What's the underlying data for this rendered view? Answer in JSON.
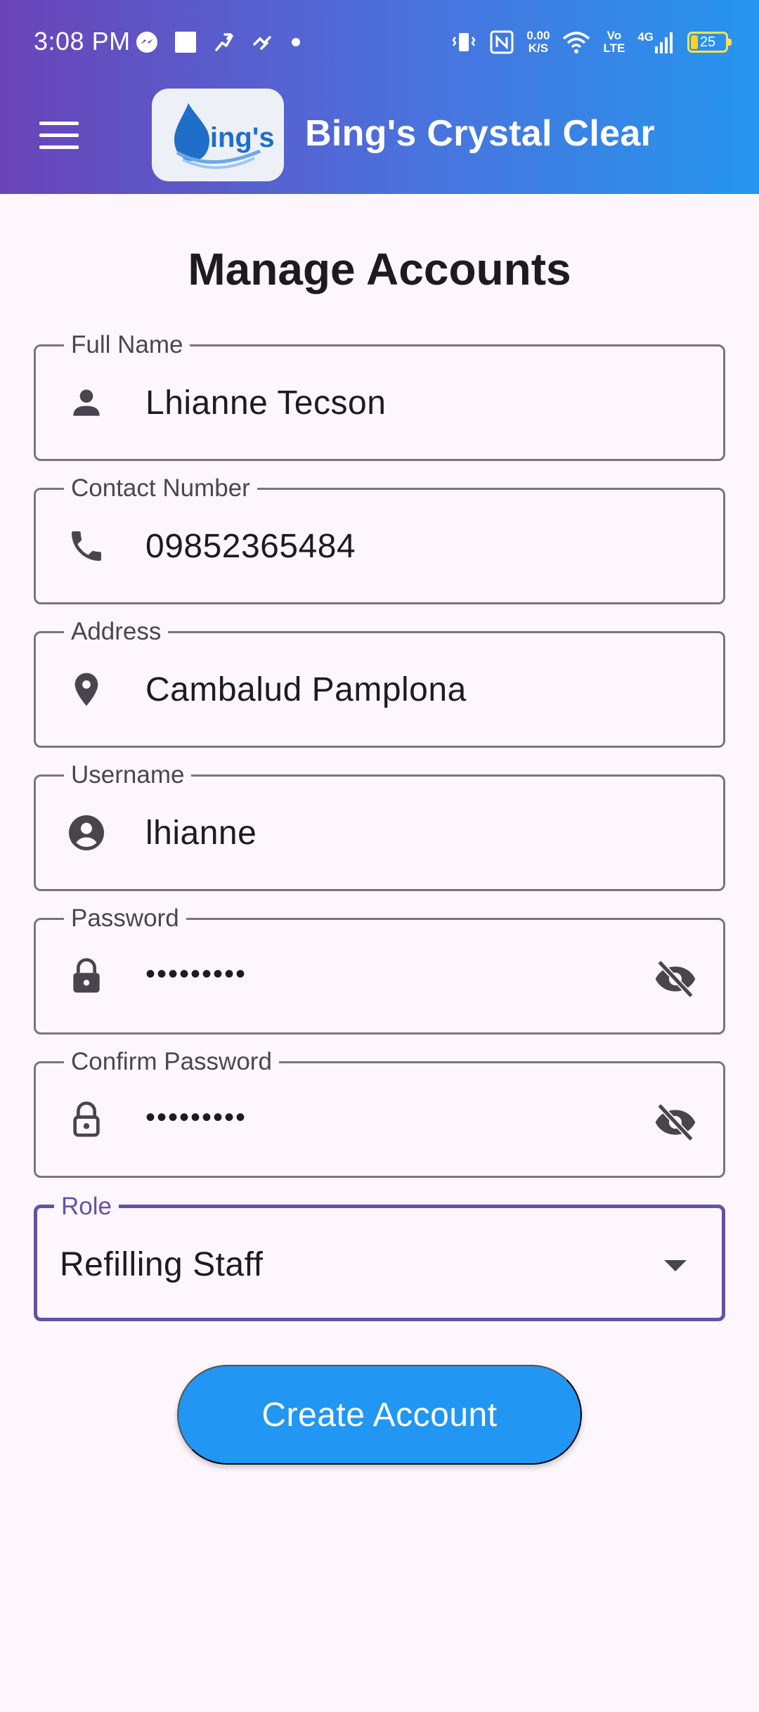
{
  "status_bar": {
    "time": "3:08 PM",
    "net_speed_value": "0.00",
    "net_speed_unit": "K/S",
    "volte_top": "Vo",
    "volte_bottom": "LTE",
    "network": "4G",
    "battery": "25"
  },
  "app_bar": {
    "title": "Bing's Crystal Clear",
    "logo_text": "Bing's",
    "menu_icon": "hamburger-menu-icon"
  },
  "page": {
    "heading": "Manage Accounts"
  },
  "form": {
    "full_name": {
      "label": "Full Name",
      "value": "Lhianne Tecson",
      "icon": "person-icon"
    },
    "contact": {
      "label": "Contact Number",
      "value": "09852365484",
      "icon": "phone-icon"
    },
    "address": {
      "label": "Address",
      "value": "Cambalud Pamplona",
      "icon": "location-pin-icon"
    },
    "username": {
      "label": "Username",
      "value": "lhianne",
      "icon": "account-circle-icon"
    },
    "password": {
      "label": "Password",
      "value": "•••••••••",
      "icon": "lock-icon"
    },
    "confirm_password": {
      "label": "Confirm Password",
      "value": "•••••••••",
      "icon": "lock-outline-icon"
    },
    "role": {
      "label": "Role",
      "value": "Refilling Staff"
    }
  },
  "actions": {
    "create_account": "Create Account"
  },
  "colors": {
    "header_gradient_start": "#6a44b8",
    "header_gradient_end": "#2596ee",
    "primary_button": "#2196f3",
    "focus_outline": "#6750a4",
    "background": "#fdf7fd"
  }
}
